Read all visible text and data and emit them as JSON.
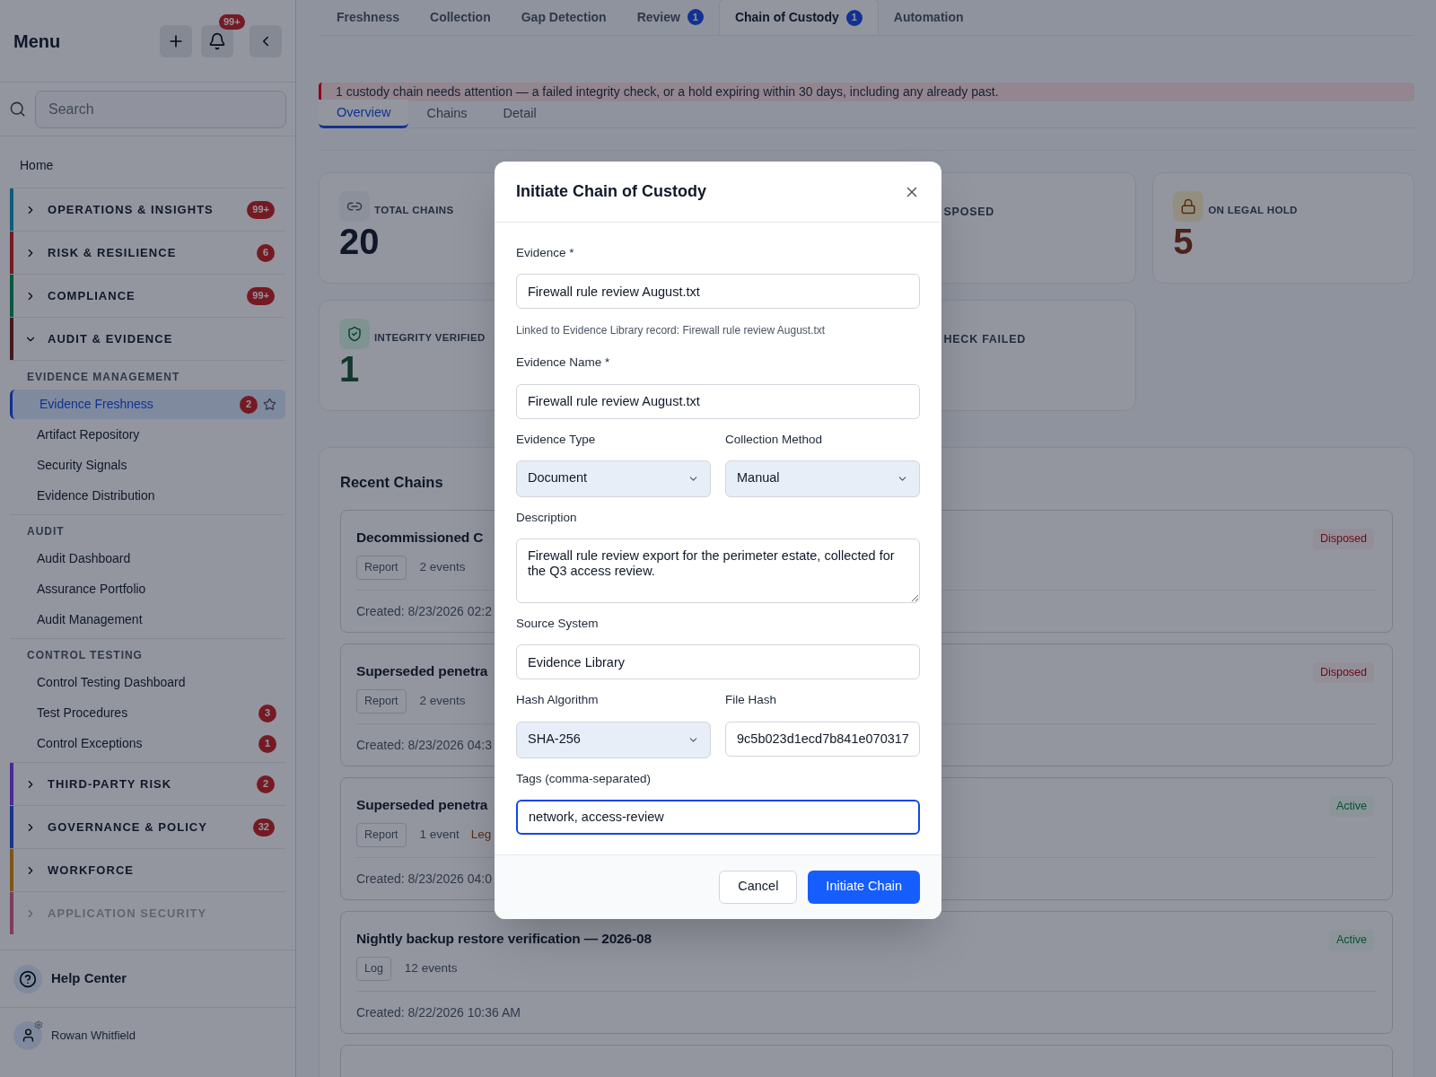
{
  "sidebar": {
    "title": "Menu",
    "notification_badge": "99+",
    "search": {
      "placeholder": "Search"
    },
    "home": "Home",
    "groups": [
      {
        "label": "OPERATIONS & INSIGHTS",
        "color": "#0f5c78",
        "badge": "99+",
        "expanded": false,
        "disabled": false
      },
      {
        "label": "RISK & RESILIENCE",
        "color": "#751b23",
        "badge": "6",
        "expanded": false,
        "disabled": false
      },
      {
        "label": "COMPLIANCE",
        "color": "#0b5544",
        "badge": "99+",
        "expanded": false,
        "disabled": false
      },
      {
        "label": "AUDIT & EVIDENCE",
        "color": "#421b1b",
        "expanded": true,
        "disabled": false,
        "sections": [
          {
            "heading": "EVIDENCE MANAGEMENT",
            "items": [
              {
                "label": "Evidence Freshness",
                "badge": "2",
                "selected": true,
                "starred": false
              },
              {
                "label": "Artifact Repository",
                "selected": false
              },
              {
                "label": "Security Signals",
                "selected": false
              },
              {
                "label": "Evidence Distribution",
                "selected": false
              }
            ]
          },
          {
            "heading": "AUDIT",
            "items": [
              {
                "label": "Audit Dashboard",
                "selected": false
              },
              {
                "label": "Assurance Portfolio",
                "selected": false
              },
              {
                "label": "Audit Management",
                "selected": false
              }
            ]
          },
          {
            "heading": "CONTROL TESTING",
            "items": [
              {
                "label": "Control Testing Dashboard",
                "selected": false
              },
              {
                "label": "Test Procedures",
                "badge": "3",
                "selected": false
              },
              {
                "label": "Control Exceptions",
                "badge": "1",
                "selected": false
              }
            ]
          }
        ]
      },
      {
        "label": "THIRD-PARTY RISK",
        "color": "#4b2a95",
        "badge": "2",
        "expanded": false,
        "disabled": false
      },
      {
        "label": "GOVERNANCE & POLICY",
        "color": "#17358a",
        "badge": "32",
        "expanded": false,
        "disabled": false
      },
      {
        "label": "WORKFORCE",
        "color": "#7e5616",
        "expanded": false,
        "disabled": false
      },
      {
        "label": "APPLICATION SECURITY",
        "color": "#7f3c5f",
        "expanded": false,
        "disabled": true
      }
    ],
    "help": "Help Center",
    "user": "Rowan Whitfield"
  },
  "tabs": [
    {
      "label": "Freshness",
      "selected": false
    },
    {
      "label": "Collection",
      "selected": false
    },
    {
      "label": "Gap Detection",
      "selected": false
    },
    {
      "label": "Review",
      "badge": "1",
      "selected": false
    },
    {
      "label": "Chain of Custody",
      "badge": "1",
      "selected": true
    },
    {
      "label": "Automation",
      "selected": false
    }
  ],
  "alert": "1 custody chain needs attention — a failed integrity check, or a hold expiring within 30 days, including any already past.",
  "subtabs": [
    {
      "label": "Overview",
      "selected": true
    },
    {
      "label": "Chains",
      "selected": false
    },
    {
      "label": "Detail",
      "selected": false
    }
  ],
  "stats": [
    {
      "kind": "total",
      "label": "TOTAL CHAINS",
      "value": "20"
    },
    {
      "kind": "partial",
      "label": "SPOSED"
    },
    {
      "kind": "legal_hold",
      "label": "ON LEGAL HOLD",
      "value": "5"
    },
    {
      "kind": "verified",
      "label": "INTEGRITY VERIFIED",
      "value": "1"
    },
    {
      "kind": "partial",
      "label": "HECK FAILED"
    }
  ],
  "recent": {
    "title": "Recent Chains",
    "chains": [
      {
        "title": "Decommissioned C",
        "type": "Report",
        "events": "2 events",
        "created": "Created: 8/23/2026 02:2",
        "status": "Disposed"
      },
      {
        "title": "Superseded penetra",
        "type": "Report",
        "events": "2 events",
        "created": "Created: 8/23/2026 04:3",
        "status": "Disposed"
      },
      {
        "title": "Superseded penetra",
        "type": "Report",
        "events": "1 event",
        "hold": "Leg",
        "created": "Created: 8/23/2026 04:0",
        "status": "Active"
      },
      {
        "title": "Nightly backup restore verification — 2026-08",
        "type": "Log",
        "events": "12 events",
        "created": "Created: 8/22/2026 10:36 AM",
        "status": "Active"
      }
    ]
  },
  "dialog": {
    "title": "Initiate Chain of Custody",
    "rows": [
      [
        {
          "kind": "text",
          "label": "Evidence *",
          "value": "Firewall rule review August.txt"
        }
      ],
      [
        {
          "kind": "hint",
          "text": "Linked to Evidence Library record: Firewall rule review August.txt"
        }
      ],
      [
        {
          "kind": "text",
          "label": "Evidence Name *",
          "value": "Firewall rule review August.txt"
        }
      ],
      [
        {
          "kind": "select",
          "label": "Evidence Type",
          "value": "Document"
        },
        {
          "kind": "select",
          "label": "Collection Method",
          "value": "Manual"
        }
      ],
      [
        {
          "kind": "textarea",
          "label": "Description",
          "value": "Firewall rule review export for the perimeter estate, collected for the Q3 access review."
        }
      ],
      [
        {
          "kind": "text",
          "label": "Source System",
          "value": "Evidence Library"
        }
      ],
      [
        {
          "kind": "select",
          "label": "Hash Algorithm",
          "value": "SHA-256"
        },
        {
          "kind": "text",
          "label": "File Hash",
          "value": "9c5b023d1ecd7b841e070317"
        }
      ],
      [
        {
          "kind": "text",
          "label": "Tags (comma-separated)",
          "value": "network, access-review",
          "focused": true
        }
      ]
    ],
    "buttons": [
      {
        "kind": "secondary",
        "label": "Cancel"
      },
      {
        "kind": "primary",
        "label": "Initiate Chain"
      }
    ]
  }
}
